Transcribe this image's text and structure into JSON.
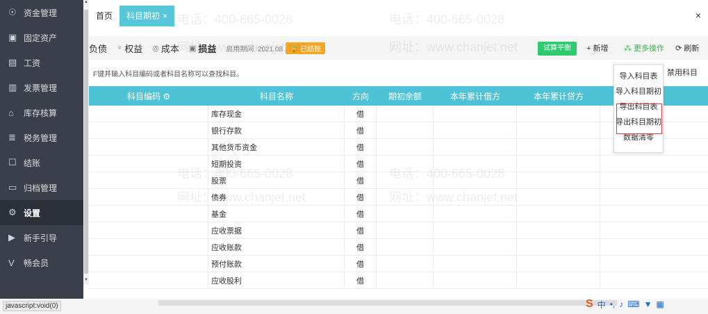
{
  "sidebar": {
    "items": [
      {
        "label": "资金管理",
        "icon": "money-icon",
        "glyph": "☉"
      },
      {
        "label": "固定资产",
        "icon": "asset-icon",
        "glyph": "▣"
      },
      {
        "label": "工资",
        "icon": "salary-icon",
        "glyph": "▤"
      },
      {
        "label": "发票管理",
        "icon": "invoice-icon",
        "glyph": "▥"
      },
      {
        "label": "库存核算",
        "icon": "warehouse-icon",
        "glyph": "⌂"
      },
      {
        "label": "税务管理",
        "icon": "tax-icon",
        "glyph": "≣"
      },
      {
        "label": "结账",
        "icon": "closing-icon",
        "glyph": "☐"
      },
      {
        "label": "归档管理",
        "icon": "archive-icon",
        "glyph": "▭"
      },
      {
        "label": "设置",
        "icon": "settings-icon",
        "glyph": "⚙"
      },
      {
        "label": "新手引导",
        "icon": "guide-icon",
        "glyph": "▶"
      },
      {
        "label": "畅会员",
        "icon": "vip-icon",
        "glyph": "V"
      }
    ],
    "active_index": 8
  },
  "tabs": [
    {
      "label": "首页"
    },
    {
      "label": "科目期初",
      "close": "×"
    }
  ],
  "window_close": "×",
  "toolbar": {
    "report_tabs": [
      {
        "label": "负债",
        "icon": ""
      },
      {
        "label": "权益",
        "icon": "♀"
      },
      {
        "label": "成本",
        "icon": "◎"
      },
      {
        "label": "损益",
        "icon": "▣"
      }
    ],
    "period": "启用期间: 2021.08",
    "closed_badge": "🔒 已结账",
    "trial_balance": "试算平衡",
    "add": "+ 新增",
    "more": "⁂ 更多操作",
    "refresh": "⟳ 刷新"
  },
  "search_hint": "F键并输入科目编码或者科目名称可以查找科目。",
  "disabled_check": "禁用科目",
  "table": {
    "headers": [
      "科目编码 ⚙",
      "科目名称",
      "方向",
      "期初余额",
      "本年累计借方",
      "本年累计贷方"
    ],
    "rows": [
      {
        "name": "库存现金",
        "dir": "借"
      },
      {
        "name": "银行存款",
        "dir": "借"
      },
      {
        "name": "其他货币资金",
        "dir": "借"
      },
      {
        "name": "短期投资",
        "dir": "借"
      },
      {
        "name": "股票",
        "dir": "借"
      },
      {
        "name": "债券",
        "dir": "借"
      },
      {
        "name": "基金",
        "dir": "借"
      },
      {
        "name": "应收票据",
        "dir": "借"
      },
      {
        "name": "应收账款",
        "dir": "借"
      },
      {
        "name": "预付账款",
        "dir": "借"
      },
      {
        "name": "应收股利",
        "dir": "借"
      }
    ]
  },
  "dropdown": {
    "items": [
      "导入科目表",
      "导入科目期初",
      "导出科目表",
      "导出科目期初",
      "数据清零"
    ]
  },
  "status_text": "javascript:void(0)",
  "watermark": {
    "phone": "电话：400-665-0028",
    "site": "网址：www.chanjet.net"
  }
}
